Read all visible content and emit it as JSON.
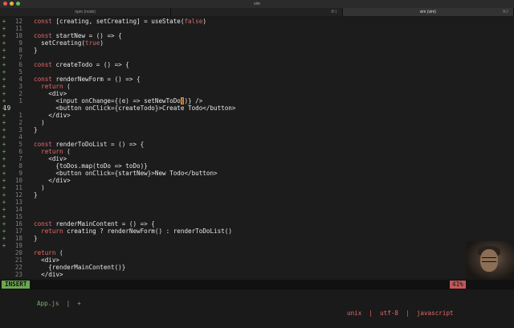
{
  "window": {
    "title": "vim",
    "tabs": [
      {
        "label": "npm (node)",
        "kbd": "",
        "active": false
      },
      {
        "label": "",
        "kbd": "⌘1",
        "active": false
      },
      {
        "label": "vim (vim)",
        "kbd": "⌘2",
        "active": true
      }
    ]
  },
  "colors": {
    "keyword": "#e86a6a",
    "string": "#d0a060",
    "insert_mode": "#6aa84f",
    "cursor": "#e9872e",
    "gutter_sign": "#7fae6a"
  },
  "editor": {
    "lines": [
      {
        "sign": "+",
        "num": "12",
        "tokens": [
          [
            "kw",
            "const "
          ],
          [
            "fn",
            "[creating, setCreating] = useState("
          ],
          [
            "val",
            "false"
          ],
          [
            "fn",
            ")"
          ]
        ]
      },
      {
        "sign": "+",
        "num": "11",
        "tokens": []
      },
      {
        "sign": "+",
        "num": "10",
        "tokens": [
          [
            "kw",
            "const "
          ],
          [
            "fn",
            "startNew = () => {"
          ]
        ]
      },
      {
        "sign": "+",
        "num": "9",
        "tokens": [
          [
            "fn",
            "  setCreating("
          ],
          [
            "val",
            "true"
          ],
          [
            "fn",
            ")"
          ]
        ]
      },
      {
        "sign": "+",
        "num": "8",
        "tokens": [
          [
            "fn",
            "}"
          ]
        ]
      },
      {
        "sign": "+",
        "num": "7",
        "tokens": []
      },
      {
        "sign": "+",
        "num": "6",
        "tokens": [
          [
            "kw",
            "const "
          ],
          [
            "fn",
            "createTodo = () => {"
          ]
        ]
      },
      {
        "sign": "+",
        "num": "5",
        "tokens": []
      },
      {
        "sign": "+",
        "num": "4",
        "tokens": [
          [
            "kw",
            "const "
          ],
          [
            "fn",
            "renderNewForm = () => {"
          ]
        ]
      },
      {
        "sign": "+",
        "num": "3",
        "tokens": [
          [
            "kw",
            "  return "
          ],
          [
            "fn",
            "("
          ]
        ]
      },
      {
        "sign": "+",
        "num": "2",
        "tokens": [
          [
            "fn",
            "    <div>"
          ]
        ]
      },
      {
        "sign": "+",
        "num": "1",
        "tokens": [
          [
            "fn",
            "      <input onChange={(e) => setNewToDo"
          ],
          [
            "cursor",
            "("
          ],
          [
            "fn",
            ")} />"
          ]
        ],
        "current": false
      },
      {
        "sign": "+",
        "num": "19",
        "tokens": [
          [
            "fn",
            "      <button onClick={createTodo}>Create Todo</button>"
          ]
        ],
        "current": true
      },
      {
        "sign": "+",
        "num": "1",
        "tokens": [
          [
            "fn",
            "    </div>"
          ]
        ]
      },
      {
        "sign": "+",
        "num": "2",
        "tokens": [
          [
            "fn",
            "  )"
          ]
        ]
      },
      {
        "sign": "+",
        "num": "3",
        "tokens": [
          [
            "fn",
            "}"
          ]
        ]
      },
      {
        "sign": "+",
        "num": "4",
        "tokens": []
      },
      {
        "sign": "+",
        "num": "5",
        "tokens": [
          [
            "kw",
            "const "
          ],
          [
            "fn",
            "renderToDoList = () => {"
          ]
        ]
      },
      {
        "sign": "+",
        "num": "6",
        "tokens": [
          [
            "kw",
            "  return "
          ],
          [
            "fn",
            "("
          ]
        ]
      },
      {
        "sign": "+",
        "num": "7",
        "tokens": [
          [
            "fn",
            "    <div>"
          ]
        ]
      },
      {
        "sign": "+",
        "num": "8",
        "tokens": [
          [
            "fn",
            "      {toDos.map(toDo => toDo)}"
          ]
        ]
      },
      {
        "sign": "+",
        "num": "9",
        "tokens": [
          [
            "fn",
            "      <button onClick={startNew}>New Todo</button>"
          ]
        ]
      },
      {
        "sign": "+",
        "num": "10",
        "tokens": [
          [
            "fn",
            "    </div>"
          ]
        ]
      },
      {
        "sign": "+",
        "num": "11",
        "tokens": [
          [
            "fn",
            "  )"
          ]
        ]
      },
      {
        "sign": "+",
        "num": "12",
        "tokens": [
          [
            "fn",
            "}"
          ]
        ]
      },
      {
        "sign": "+",
        "num": "13",
        "tokens": []
      },
      {
        "sign": "+",
        "num": "14",
        "tokens": []
      },
      {
        "sign": "+",
        "num": "15",
        "tokens": []
      },
      {
        "sign": "+",
        "num": "16",
        "tokens": [
          [
            "kw",
            "const "
          ],
          [
            "fn",
            "renderMainContent = () => {"
          ]
        ]
      },
      {
        "sign": "+",
        "num": "17",
        "tokens": [
          [
            "kw",
            "  return "
          ],
          [
            "fn",
            "creating ? renderNewForm() : renderToDoList()"
          ]
        ]
      },
      {
        "sign": "+",
        "num": "18",
        "tokens": [
          [
            "fn",
            "}"
          ]
        ]
      },
      {
        "sign": "+",
        "num": "19",
        "tokens": []
      },
      {
        "sign": "",
        "num": "20",
        "tokens": [
          [
            "kw",
            "return "
          ],
          [
            "fn",
            "("
          ]
        ]
      },
      {
        "sign": "",
        "num": "21",
        "tokens": [
          [
            "fn",
            "  <div>"
          ]
        ]
      },
      {
        "sign": "",
        "num": "22",
        "tokens": [
          [
            "fn",
            "    {renderMainContent()}"
          ]
        ]
      },
      {
        "sign": "",
        "num": "23",
        "tokens": [
          [
            "fn",
            "  </div>"
          ]
        ]
      }
    ]
  },
  "statusbar": {
    "mode": "INSERT",
    "filename": "App.js  |  +",
    "right": "unix  |  utf-8  |  javascript",
    "percent": "41%"
  }
}
